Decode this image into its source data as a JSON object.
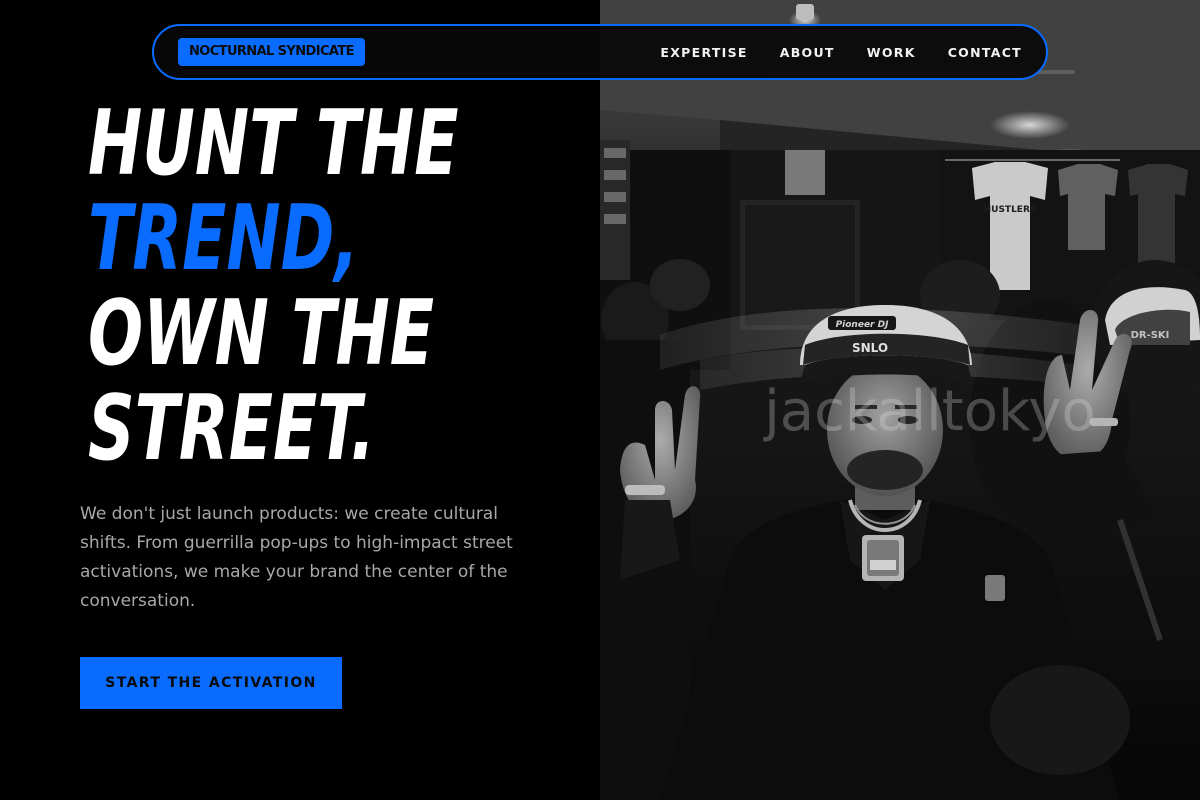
{
  "nav": {
    "brand": "NOCTURNAL SYNDICATE",
    "links": [
      "EXPERTISE",
      "ABOUT",
      "WORK",
      "CONTACT"
    ]
  },
  "hero": {
    "headline": [
      "HUNT THE",
      "TREND,",
      "OWN THE",
      "STREET."
    ],
    "description": "We don't just launch products: we create cultural shifts. From guerrilla pop-ups to high-impact street activations, we make your brand the center of the conversation.",
    "cta_label": "START THE ACTIVATION"
  },
  "photo": {
    "watermark": "jackalltokyo",
    "cap_text": "Pioneer DJ",
    "shirt_text": "HUSTLERS",
    "alt": "Black and white photo of a man in a trucker cap making peace signs in a nightclub"
  },
  "colors": {
    "accent": "#0a6cff",
    "background": "#000000",
    "headline": "#ffffff",
    "body_text": "#a8a8a8"
  }
}
